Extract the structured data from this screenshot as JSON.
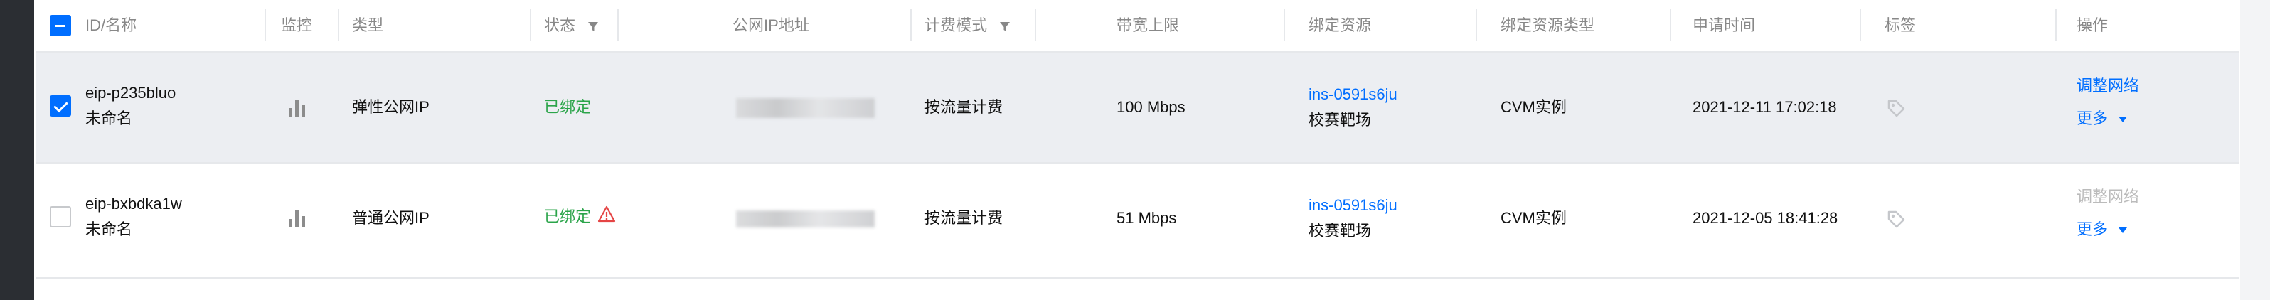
{
  "columns": {
    "id_name": "ID/名称",
    "monitor": "监控",
    "type": "类型",
    "status": "状态",
    "public_ip": "公网IP地址",
    "billing": "计费模式",
    "bandwidth": "带宽上限",
    "bound_resource": "绑定资源",
    "bound_resource_type": "绑定资源类型",
    "apply_time": "申请时间",
    "tags": "标签",
    "actions": "操作"
  },
  "rows": [
    {
      "selected": true,
      "id": "eip-p235bluo",
      "name": "未命名",
      "type": "弹性公网IP",
      "status": "已绑定",
      "billing": "按流量计费",
      "bandwidth": "100 Mbps",
      "resource_id": "ins-0591s6ju",
      "resource_name": "校赛靶场",
      "resource_type": "CVM实例",
      "apply_time": "2021-12-11 17:02:18",
      "action_primary": "调整网络",
      "action_more": "更多"
    },
    {
      "selected": false,
      "id": "eip-bxbdka1w",
      "name": "未命名",
      "type": "普通公网IP",
      "status": "已绑定",
      "billing": "按流量计费",
      "bandwidth": "51 Mbps",
      "resource_id": "ins-0591s6ju",
      "resource_name": "校赛靶场",
      "resource_type": "CVM实例",
      "apply_time": "2021-12-05 18:41:28",
      "action_primary": "调整网络",
      "action_more": "更多"
    }
  ],
  "colors": {
    "link": "#006eff",
    "status_bound": "#2ba44a",
    "row_selected_bg": "#eceef2",
    "header_text": "#888888",
    "warning_icon": "#e54545"
  }
}
